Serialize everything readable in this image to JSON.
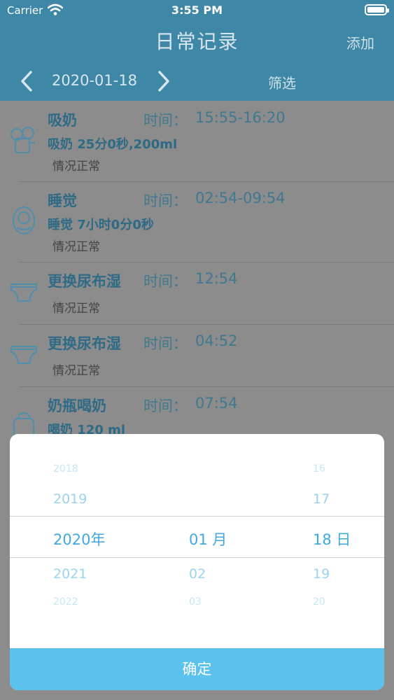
{
  "status_bar": {
    "carrier": "Carrier",
    "time": "3:55 PM"
  },
  "nav": {
    "title": "日常记录",
    "add_label": "添加"
  },
  "date_bar": {
    "date": "2020-01-18",
    "filter_label": "筛选"
  },
  "records": [
    {
      "icon": "breast-pump-icon",
      "title": "吸奶",
      "time_label": "时间：",
      "time": "15:55-16:20",
      "detail": "吸奶 25分0秒,200ml",
      "status": "情况正常"
    },
    {
      "icon": "sleeping-baby-icon",
      "title": "睡觉",
      "time_label": "时间：",
      "time": "02:54-09:54",
      "detail": "睡觉 7小时0分0秒",
      "status": "情况正常"
    },
    {
      "icon": "diaper-icon",
      "title": "更换尿布湿",
      "time_label": "时间：",
      "time": "12:54",
      "detail": "",
      "status": "情况正常"
    },
    {
      "icon": "diaper-icon",
      "title": "更换尿布湿",
      "time_label": "时间：",
      "time": "04:52",
      "detail": "",
      "status": "情况正常"
    },
    {
      "icon": "baby-bottle-icon",
      "title": "奶瓶喝奶",
      "time_label": "时间：",
      "time": "07:54",
      "detail": "喝奶 120 ml",
      "status": ""
    }
  ],
  "picker": {
    "year": {
      "far_prev": "2018",
      "prev": "2019",
      "selected": "2020年",
      "next": "2021",
      "far_next": "2022"
    },
    "month": {
      "selected": "01 月",
      "next": "02",
      "far_next": "03"
    },
    "day": {
      "far_prev": "16",
      "prev": "17",
      "selected": "18 日",
      "next": "19",
      "far_next": "20"
    },
    "confirm_label": "确定"
  },
  "colors": {
    "header": "#3f87a6",
    "accent": "#5bc1ed",
    "dimmed_list": "#8c8c8c"
  }
}
